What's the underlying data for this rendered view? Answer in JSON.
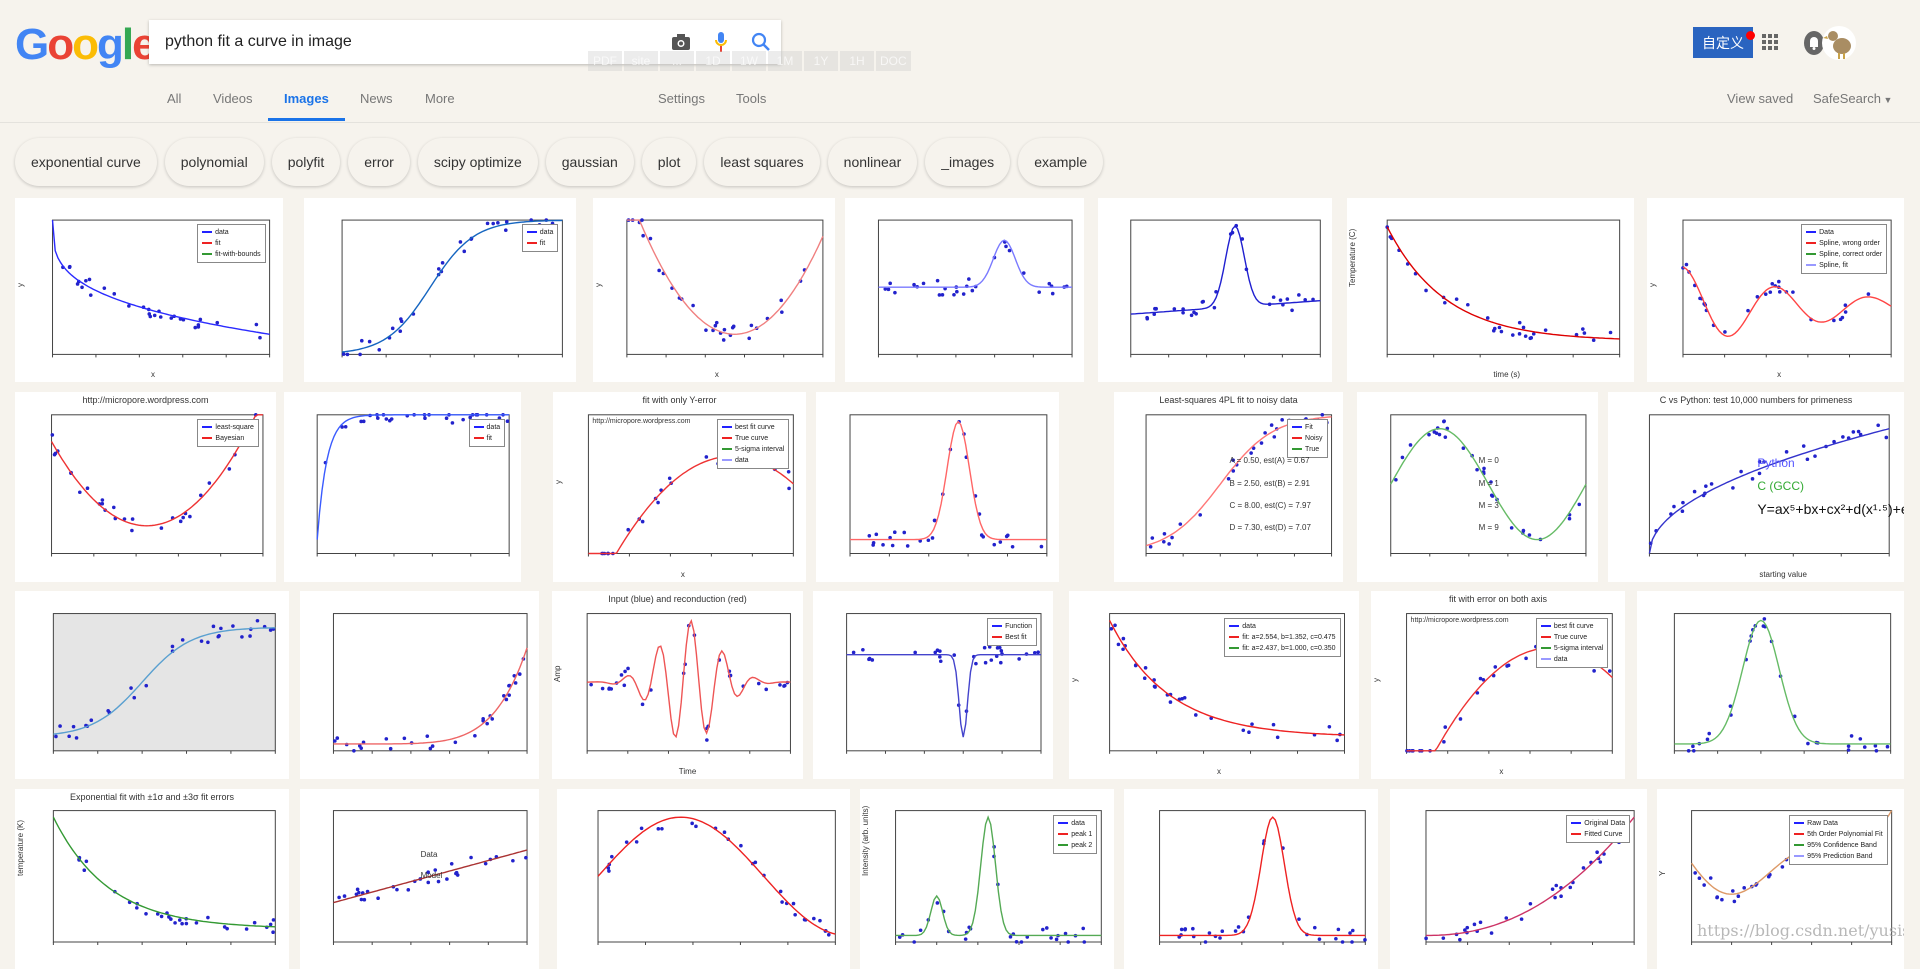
{
  "logo": {
    "text": "Google",
    "letters": [
      "G",
      "o",
      "o",
      "g",
      "l",
      "e"
    ],
    "colors": [
      "#4285f4",
      "#ea4335",
      "#fbbc05",
      "#4285f4",
      "#34a853",
      "#ea4335"
    ]
  },
  "search": {
    "value": "python fit a curve in image",
    "icons": [
      "camera-icon",
      "microphone-icon",
      "search-icon"
    ]
  },
  "quick_filters": [
    "PDF",
    "site",
    "...",
    "1D",
    "1W",
    "1M",
    "1Y",
    "1H",
    "DOC"
  ],
  "header_right": {
    "customize_label": "自定义",
    "accent": "#2a64c0"
  },
  "tabs": [
    {
      "label": "All"
    },
    {
      "label": "Videos"
    },
    {
      "label": "Images",
      "active": true
    },
    {
      "label": "News"
    },
    {
      "label": "More"
    }
  ],
  "tools": {
    "settings": "Settings",
    "tools": "Tools",
    "view_saved": "View saved",
    "safesearch": "SafeSearch"
  },
  "chips": [
    "exponential curve",
    "polynomial",
    "polyfit",
    "error",
    "scipy optimize",
    "gaussian",
    "plot",
    "least squares",
    "nonlinear",
    "_images",
    "example"
  ],
  "results": [
    [
      {
        "legend": [
          "data",
          "fit",
          "fit-with-bounds"
        ],
        "xlabel": "x",
        "ylabel": "y"
      },
      {
        "legend": [
          "data",
          "fit"
        ]
      },
      {
        "xlabel": "x",
        "ylabel": "y"
      },
      {},
      {},
      {
        "xlabel": "time (s)",
        "ylabel": "Temperature (C)"
      },
      {
        "legend": [
          "Data",
          "Spline, wrong order",
          "Spline, correct order",
          "Spline, fit"
        ],
        "xlabel": "x",
        "ylabel": "y"
      }
    ],
    [
      {
        "title": "http://micropore.wordpress.com",
        "legend": [
          "least-square",
          "Bayesian"
        ]
      },
      {
        "legend": [
          "data",
          "fit"
        ]
      },
      {
        "title": "fit with only Y-error",
        "subtitle": "http://micropore.wordpress.com",
        "legend": [
          "best fit curve",
          "True curve",
          "5-sigma interval",
          "data"
        ],
        "xlabel": "x",
        "ylabel": "y"
      },
      {},
      {
        "title": "Least-squares 4PL fit to noisy data",
        "legend": [
          "Fit",
          "Noisy",
          "True"
        ],
        "notes": [
          "A = 0.50, est(A) = 0.67",
          "B = 2.50, est(B) = 2.91",
          "C = 8.00, est(C) = 7.97",
          "D = 7.30, est(D) = 7.07"
        ]
      },
      {
        "notes": [
          "M = 0",
          "M = 1",
          "M = 3",
          "M = 9"
        ]
      },
      {
        "title": "C vs Python: test 10,000 numbers for primeness",
        "notes": [
          "Python",
          "C (GCC)",
          "Y=ax⁵+bx+cx²+d(x¹·⁵)+e"
        ],
        "xlabel": "starting value"
      }
    ],
    [
      {},
      {},
      {
        "title": "Input (blue) and reconduction (red)",
        "xlabel": "Time",
        "ylabel": "Amp"
      },
      {
        "legend": [
          "Function",
          "Best fit"
        ]
      },
      {
        "legend": [
          "data",
          "fit: a=2.554, b=1.352, c=0.475",
          "fit: a=2.437, b=1.000, c=0.350"
        ],
        "xlabel": "x",
        "ylabel": "y"
      },
      {
        "title": "fit with error on both axis",
        "subtitle": "http://micropore.wordpress.com",
        "legend": [
          "best fit curve",
          "True curve",
          "5-sigma interval",
          "data"
        ],
        "xlabel": "x",
        "ylabel": "y"
      },
      {}
    ],
    [
      {
        "title": "Exponential fit with ±1σ and ±3σ fit errors",
        "ylabel": "temperature (K)"
      },
      {
        "notes": [
          "Data",
          "Model"
        ]
      },
      {},
      {
        "legend": [
          "data",
          "peak 1",
          "peak 2"
        ],
        "ylabel": "Intensity (arb. units)"
      },
      {},
      {
        "legend": [
          "Original Data",
          "Fitted Curve"
        ]
      },
      {
        "legend": [
          "Raw Data",
          "5th Order Polynomial Fit",
          "95% Confidence Band",
          "95% Prediction Band"
        ],
        "ylabel": "Y",
        "watermark": "https://blog.csdn.net/yusisc"
      }
    ]
  ]
}
